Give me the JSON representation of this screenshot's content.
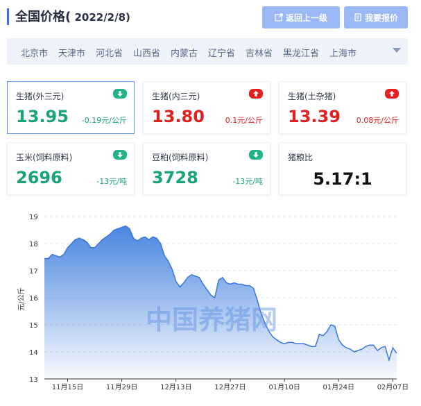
{
  "header": {
    "title_main": "全国价格(",
    "title_date": " 2022/2/8)",
    "back_button": "返回上一级",
    "report_button": "我要报价"
  },
  "regions": [
    "北京市",
    "天津市",
    "河北省",
    "山西省",
    "内蒙古",
    "辽宁省",
    "吉林省",
    "黑龙江省",
    "上海市"
  ],
  "cards": [
    {
      "name": "生猪(外三元)",
      "price": "13.95",
      "change": "-0.19元/公斤",
      "trend": "down"
    },
    {
      "name": "生猪(内三元)",
      "price": "13.80",
      "change": "0.1元/公斤",
      "trend": "up"
    },
    {
      "name": "生猪(土杂猪)",
      "price": "13.39",
      "change": "0.08元/公斤",
      "trend": "up"
    },
    {
      "name": "玉米(饲料原料)",
      "price": "2696",
      "change": "-13元/吨",
      "trend": "down"
    },
    {
      "name": "豆粕(饲料原料)",
      "price": "3728",
      "change": "-13元/吨",
      "trend": "down"
    },
    {
      "name": "猪粮比",
      "price": "5.17:1"
    }
  ],
  "watermark": "中国养猪网",
  "colors": {
    "accent": "#3a6fd8",
    "up": "#e02020",
    "down": "#1aa37a",
    "area": "#4a86e0"
  },
  "chart_data": {
    "type": "area",
    "ylabel": "元/公斤",
    "ylim": [
      13,
      19
    ],
    "yticks": [
      13,
      14,
      15,
      16,
      17,
      18,
      19
    ],
    "xlim": [
      "2021-11-09",
      "2022-02-08"
    ],
    "xticks": [
      "11月15日",
      "11月29日",
      "12月13日",
      "12月27日",
      "01月10日",
      "01月24日",
      "02月07日"
    ],
    "grid": true,
    "series": [
      {
        "points": [
          [
            "2021-11-09",
            17.45
          ],
          [
            "2021-11-10",
            17.45
          ],
          [
            "2021-11-11",
            17.6
          ],
          [
            "2021-11-12",
            17.55
          ],
          [
            "2021-11-13",
            17.5
          ],
          [
            "2021-11-14",
            17.6
          ],
          [
            "2021-11-15",
            17.85
          ],
          [
            "2021-11-16",
            18.0
          ],
          [
            "2021-11-17",
            18.15
          ],
          [
            "2021-11-18",
            18.2
          ],
          [
            "2021-11-19",
            18.15
          ],
          [
            "2021-11-20",
            18.05
          ],
          [
            "2021-11-21",
            17.85
          ],
          [
            "2021-11-22",
            17.85
          ],
          [
            "2021-11-23",
            18.0
          ],
          [
            "2021-11-24",
            18.15
          ],
          [
            "2021-11-25",
            18.25
          ],
          [
            "2021-11-26",
            18.35
          ],
          [
            "2021-11-27",
            18.5
          ],
          [
            "2021-11-28",
            18.55
          ],
          [
            "2021-11-29",
            18.6
          ],
          [
            "2021-11-30",
            18.65
          ],
          [
            "2021-12-01",
            18.55
          ],
          [
            "2021-12-02",
            18.2
          ],
          [
            "2021-12-03",
            18.1
          ],
          [
            "2021-12-04",
            18.2
          ],
          [
            "2021-12-05",
            18.25
          ],
          [
            "2021-12-06",
            18.15
          ],
          [
            "2021-12-07",
            18.25
          ],
          [
            "2021-12-08",
            18.2
          ],
          [
            "2021-12-09",
            18.0
          ],
          [
            "2021-12-10",
            17.55
          ],
          [
            "2021-12-11",
            17.35
          ],
          [
            "2021-12-12",
            17.05
          ],
          [
            "2021-12-13",
            16.6
          ],
          [
            "2021-12-14",
            16.4
          ],
          [
            "2021-12-15",
            16.55
          ],
          [
            "2021-12-16",
            16.75
          ],
          [
            "2021-12-17",
            16.85
          ],
          [
            "2021-12-18",
            16.8
          ],
          [
            "2021-12-19",
            16.75
          ],
          [
            "2021-12-20",
            16.5
          ],
          [
            "2021-12-21",
            16.3
          ],
          [
            "2021-12-22",
            16.1
          ],
          [
            "2021-12-23",
            16.0
          ],
          [
            "2021-12-24",
            16.65
          ],
          [
            "2021-12-25",
            16.75
          ],
          [
            "2021-12-26",
            16.55
          ],
          [
            "2021-12-27",
            16.5
          ],
          [
            "2021-12-28",
            16.55
          ],
          [
            "2021-12-29",
            16.5
          ],
          [
            "2021-12-30",
            16.5
          ],
          [
            "2021-12-31",
            16.45
          ],
          [
            "2022-01-01",
            16.45
          ],
          [
            "2022-01-02",
            16.35
          ],
          [
            "2022-01-03",
            15.9
          ],
          [
            "2022-01-04",
            15.4
          ],
          [
            "2022-01-05",
            15.05
          ],
          [
            "2022-01-06",
            14.75
          ],
          [
            "2022-01-07",
            14.55
          ],
          [
            "2022-01-08",
            14.45
          ],
          [
            "2022-01-09",
            14.35
          ],
          [
            "2022-01-10",
            14.3
          ],
          [
            "2022-01-11",
            14.35
          ],
          [
            "2022-01-12",
            14.35
          ],
          [
            "2022-01-13",
            14.3
          ],
          [
            "2022-01-14",
            14.3
          ],
          [
            "2022-01-15",
            14.3
          ],
          [
            "2022-01-16",
            14.25
          ],
          [
            "2022-01-17",
            14.2
          ],
          [
            "2022-01-18",
            14.2
          ],
          [
            "2022-01-19",
            14.65
          ],
          [
            "2022-01-20",
            14.6
          ],
          [
            "2022-01-21",
            14.75
          ],
          [
            "2022-01-22",
            15.0
          ],
          [
            "2022-01-23",
            14.95
          ],
          [
            "2022-01-24",
            14.45
          ],
          [
            "2022-01-25",
            14.25
          ],
          [
            "2022-01-26",
            14.15
          ],
          [
            "2022-01-27",
            14.1
          ],
          [
            "2022-01-28",
            14.0
          ],
          [
            "2022-01-29",
            14.05
          ],
          [
            "2022-01-30",
            14.1
          ],
          [
            "2022-01-31",
            14.2
          ],
          [
            "2022-02-01",
            14.25
          ],
          [
            "2022-02-02",
            14.25
          ],
          [
            "2022-02-03",
            14.05
          ],
          [
            "2022-02-04",
            14.15
          ],
          [
            "2022-02-05",
            14.2
          ],
          [
            "2022-02-06",
            13.7
          ],
          [
            "2022-02-07",
            14.15
          ],
          [
            "2022-02-08",
            13.95
          ]
        ]
      }
    ]
  }
}
